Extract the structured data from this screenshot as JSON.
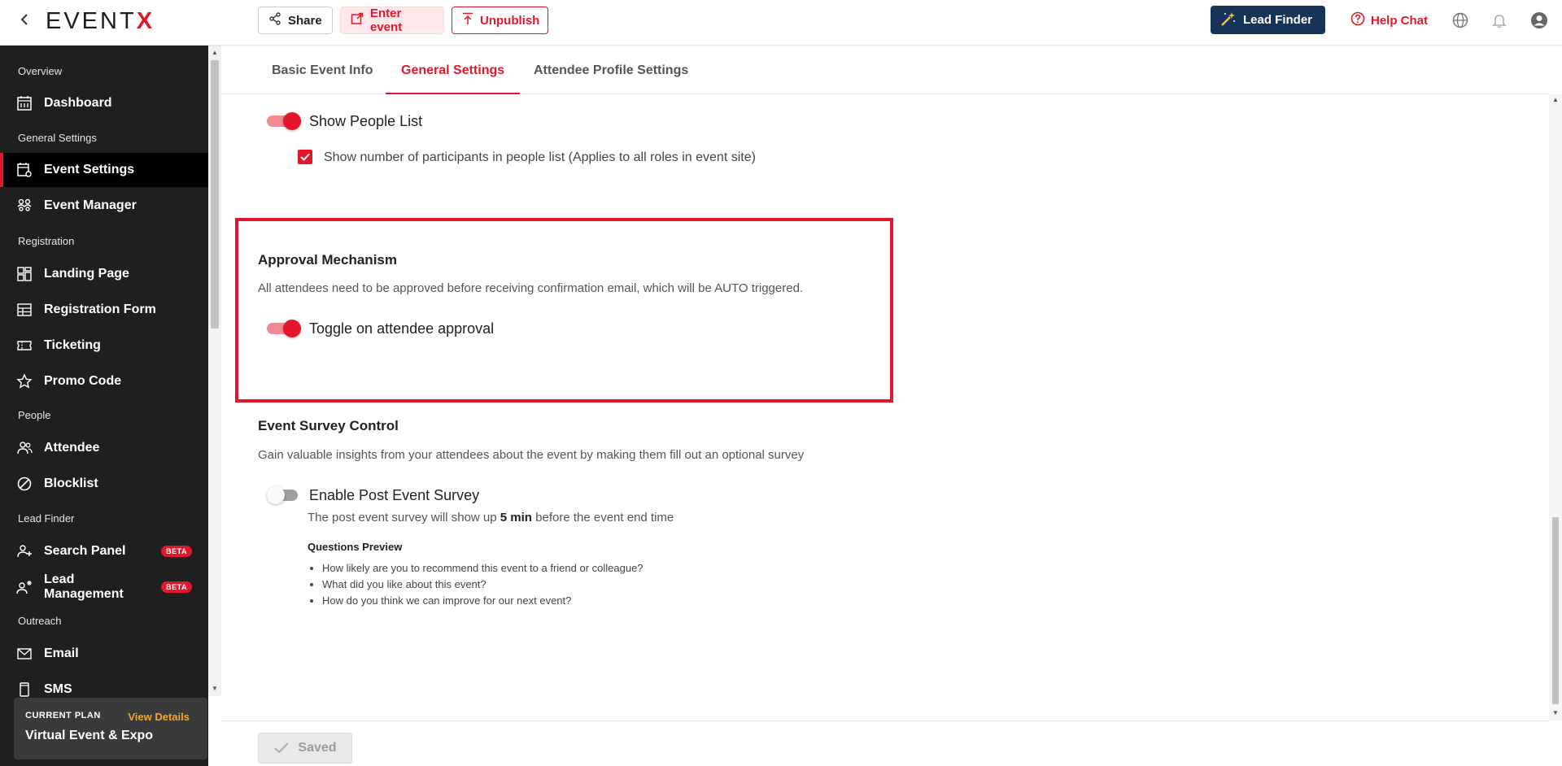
{
  "header": {
    "logo_main": "EVENT",
    "logo_accent": "X",
    "share_label": "Share",
    "enter_event_label": "Enter event",
    "unpublish_label": "Unpublish",
    "lead_finder_label": "Lead Finder",
    "help_chat_label": "Help Chat"
  },
  "sidebar": {
    "sections": {
      "overview": "Overview",
      "general_settings": "General Settings",
      "registration": "Registration",
      "people": "People",
      "lead_finder": "Lead Finder",
      "outreach": "Outreach"
    },
    "items": {
      "dashboard": "Dashboard",
      "event_settings": "Event Settings",
      "event_manager": "Event Manager",
      "landing_page": "Landing Page",
      "registration_form": "Registration Form",
      "ticketing": "Ticketing",
      "promo_code": "Promo Code",
      "attendee": "Attendee",
      "blocklist": "Blocklist",
      "search_panel": "Search Panel",
      "lead_management": "Lead Management",
      "email": "Email",
      "sms": "SMS"
    },
    "beta_label": "BETA",
    "plan": {
      "label": "CURRENT PLAN",
      "link": "View Details",
      "name": "Virtual Event & Expo"
    }
  },
  "tabs": {
    "basic": "Basic Event Info",
    "general": "General Settings",
    "attendee_profile": "Attendee Profile Settings"
  },
  "settings": {
    "show_people_list": "Show People List",
    "show_participants_count": "Show number of participants in people list (Applies to all roles in event site)",
    "approval": {
      "title": "Approval Mechanism",
      "description": "All attendees need to be approved before receiving confirmation email, which will be AUTO triggered.",
      "toggle_label": "Toggle on attendee approval"
    },
    "survey": {
      "title": "Event Survey Control",
      "description": "Gain valuable insights from your attendees about the event by making them fill out an optional survey",
      "toggle_label": "Enable Post Event Survey",
      "note_prefix": "The post event survey will show up",
      "note_bold": "5 min",
      "note_suffix": "before the event end time",
      "questions_title": "Questions Preview",
      "questions": [
        "How likely are you to recommend this event to a friend or colleague?",
        "What did you like about this event?",
        "How do you think we can improve for our next event?"
      ]
    }
  },
  "footer": {
    "saved_label": "Saved"
  },
  "colors": {
    "accent": "#e4162b",
    "sidebar_bg": "#1f1f1f",
    "lead_finder_bg": "#163458",
    "plan_link": "#f5a623"
  }
}
